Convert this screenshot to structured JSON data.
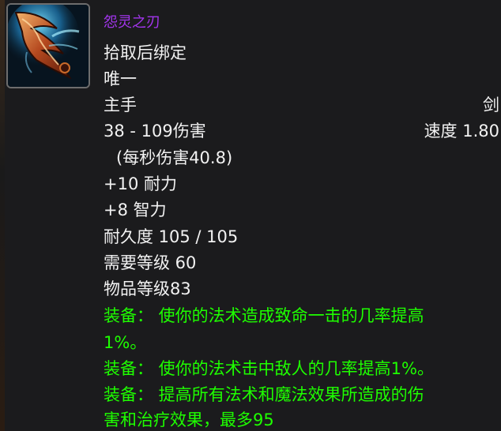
{
  "item": {
    "name": "怨灵之刃",
    "bind": "拾取后绑定",
    "unique": "唯一",
    "slot": "主手",
    "type": "剑",
    "damage": "38 - 109伤害",
    "speed": "速度 1.80",
    "dps": "(每秒伤害40.8)",
    "stamina": "+10 耐力",
    "intellect": "+8 智力",
    "durability": "耐久度 105 / 105",
    "required_level": "需要等级 60",
    "item_level": "物品等级83",
    "equip_effects": [
      {
        "line1": "装备： 使你的法术造成致命一击的几率提高",
        "line2": "1%。"
      },
      {
        "line1": "装备： 使你的法术击中敌人的几率提高1%。"
      },
      {
        "line1": "装备： 提高所有法术和魔法效果所造成的伤",
        "line2": "害和治疗效果，最多95"
      }
    ]
  },
  "icon": "curved-blade-icon",
  "colors": {
    "background": "#1b1b1d",
    "epic": "#a335ee",
    "white": "#f2f2f2",
    "equip_green": "#1eff00"
  }
}
